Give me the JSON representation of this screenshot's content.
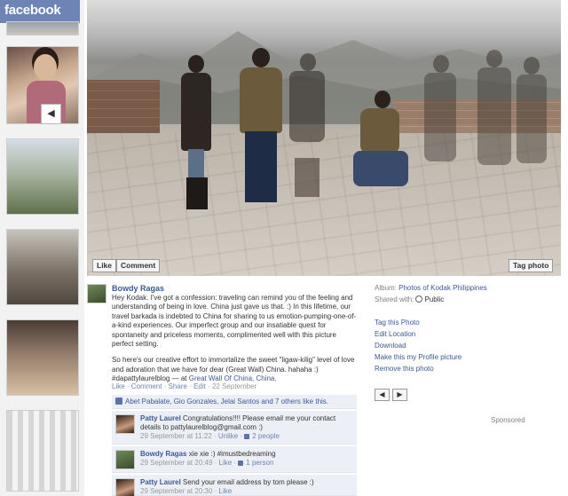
{
  "app": {
    "logo": "facebook"
  },
  "filmstrip": {
    "prev_arrow": "◀",
    "thumbnails": [
      "thumb-1",
      "thumb-2",
      "thumb-3",
      "thumb-4",
      "thumb-5",
      "thumb-6"
    ]
  },
  "photo": {
    "like_label": "Like",
    "comment_label": "Comment",
    "tag_label": "Tag photo"
  },
  "post": {
    "author": "Bowdy Ragas",
    "caption_p1": "Hey Kodak. I've got a confession: traveling can remind you of the feeling and understanding of being in love. China just gave us that. :) In this lifetime, our travel barkada is indebted to China for sharing to us emotion-pumping-one-of-a-kind experiences. Our imperfect group and our insatiable quest for spontaneity and priceless moments, complimented well with this picture perfect setting.",
    "caption_p2": "So here's our creative effort to immortalize the sweet \"ligaw-kilig\" level of love and adoration that we have for dear (Great Wall) China. hahaha :) #dapattylaurelblog — at ",
    "caption_location": "Great Wall Of China, China.",
    "actions": {
      "like": "Like",
      "comment": "Comment",
      "share": "Share",
      "edit": "Edit",
      "date": "22 September",
      "sep": " · "
    }
  },
  "likes": {
    "text": "Abet Pabalate, Gio Gonzales, Jelai Santos and 7 others like this."
  },
  "comments": [
    {
      "author": "Patty Laurel",
      "text": "Congratulations!!!! Please email me your contact details to pattylaurelblog@gmail.com :)",
      "time": "29 September at 11:22",
      "unlike": "Unlike",
      "likes": "2 people"
    },
    {
      "author": "Bowdy Ragas",
      "text": "xie xie :) #imustbedreaming",
      "time": "29 September at 20:49",
      "like": "Like",
      "likes": "1 person"
    },
    {
      "author": "Patty Laurel",
      "text": "Send your email address by tom please :)",
      "time": "29 September at 20:30",
      "like": "Like"
    }
  ],
  "sidebar": {
    "album_label": "Album:",
    "album_name": "Photos of Kodak Philippines",
    "shared_label": "Shared with:",
    "shared_value": "Public",
    "actions": [
      "Tag this Photo",
      "Edit Location",
      "Download",
      "Make this my Profile picture",
      "Remove this photo"
    ],
    "prev_label": "◀",
    "next_label": "▶",
    "sponsored": "Sponsored"
  },
  "colors": {
    "fb_blue": "#3b5998",
    "fb_header": "#6d84b4",
    "comment_bg": "#eceff5"
  }
}
